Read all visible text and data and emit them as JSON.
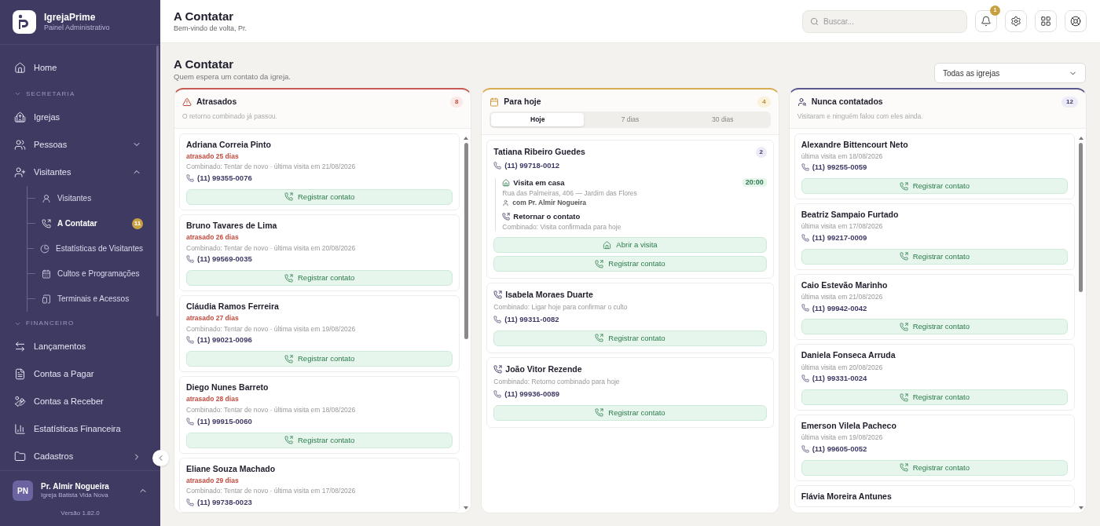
{
  "sidebar": {
    "brand": {
      "name": "IgrejaPrime",
      "subtitle": "Painel Administrativo"
    },
    "nav": [
      {
        "kind": "item",
        "label": "Home",
        "selected": false
      },
      {
        "kind": "section",
        "label": "SECRETARIA",
        "expanded": true
      },
      {
        "kind": "item",
        "label": "Igrejas",
        "selected": false
      },
      {
        "kind": "group",
        "label": "Pessoas",
        "expanded": false
      },
      {
        "kind": "group",
        "label": "Visitantes",
        "expanded": true,
        "children": [
          {
            "label": "Visitantes",
            "selected": false
          },
          {
            "label": "A Contatar",
            "selected": true,
            "badge": "11"
          },
          {
            "label": "Estatísticas de Visitantes",
            "selected": false
          },
          {
            "label": "Cultos e Programações",
            "selected": false
          },
          {
            "label": "Terminais e Acessos",
            "selected": false
          }
        ]
      },
      {
        "kind": "section",
        "label": "FINANCEIRO",
        "expanded": true
      },
      {
        "kind": "item",
        "label": "Lançamentos",
        "selected": false
      },
      {
        "kind": "item",
        "label": "Contas a Pagar",
        "selected": false
      },
      {
        "kind": "item",
        "label": "Contas a Receber",
        "selected": false
      },
      {
        "kind": "item",
        "label": "Estatísticas Financeira",
        "selected": false
      },
      {
        "kind": "link",
        "label": "Cadastros"
      }
    ],
    "user": {
      "initials": "PN",
      "name": "Pr. Almir Nogueira",
      "church": "Igreja Batista Vida Nova"
    },
    "version": "Versão 1.82.0"
  },
  "header": {
    "title": "A Contatar",
    "subtitle": "Bem-vindo de volta, Pr.",
    "search": {
      "placeholder": "Buscar..."
    },
    "notifications": "1"
  },
  "page": {
    "title": "A Contatar",
    "subtitle": "Quem espera um contato da igreja.",
    "filter": "Todas as igrejas"
  },
  "columns": [
    {
      "kind": "overdue",
      "title": "Atrasados",
      "count": "8",
      "subtitle": "O retorno combinado já passou.",
      "color": "#c65a54",
      "items": [
        {
          "name": "Adriana Correia Pinto",
          "late": "atrasado 25 dias",
          "note": "Combinado: Tentar de novo · última visita em 21/08/2026",
          "phone": "(11) 99355-0076",
          "action": "Registrar contato"
        },
        {
          "name": "Bruno Tavares de Lima",
          "late": "atrasado 26 dias",
          "note": "Combinado: Tentar de novo · última visita em 20/08/2026",
          "phone": "(11) 99569-0035",
          "action": "Registrar contato"
        },
        {
          "name": "Cláudia Ramos Ferreira",
          "late": "atrasado 27 dias",
          "note": "Combinado: Tentar de novo · última visita em 19/08/2026",
          "phone": "(11) 99021-0096",
          "action": "Registrar contato"
        },
        {
          "name": "Diego Nunes Barreto",
          "late": "atrasado 28 dias",
          "note": "Combinado: Tentar de novo · última visita em 18/08/2026",
          "phone": "(11) 99915-0060",
          "action": "Registrar contato"
        },
        {
          "name": "Eliane Souza Machado",
          "late": "atrasado 29 dias",
          "note": "Combinado: Tentar de novo · última visita em 17/08/2026",
          "phone": "(11) 99738-0023"
        }
      ]
    },
    {
      "kind": "today",
      "title": "Para hoje",
      "count": "4",
      "color": "#d9ac55",
      "tabs": [
        {
          "label": "Hoje",
          "selected": true
        },
        {
          "label": "7 dias",
          "selected": false
        },
        {
          "label": "30 dias",
          "selected": false
        }
      ],
      "items": [
        {
          "kind": "visit",
          "name": "Tatiana Ribeiro Guedes",
          "badge": "2",
          "phone": "(11) 99718-0012",
          "visit": {
            "title": "Visita em casa",
            "time": "20:00",
            "address": "Rua das Palmeiras, 406 — Jardim das Flores",
            "with": "com Pr. Almir Nogueira"
          },
          "callback": {
            "title": "Retornar o contato",
            "note": "Combinado: Visita confirmada para hoje"
          },
          "actions": [
            "Abrir a visita",
            "Registrar contato"
          ]
        },
        {
          "kind": "call",
          "name": "Isabela Moraes Duarte",
          "note": "Combinado: Ligar hoje para confirmar o culto",
          "phone": "(11) 99311-0082",
          "actions": [
            "Registrar contato"
          ]
        },
        {
          "kind": "call",
          "name": "João Vitor Rezende",
          "note": "Combinado: Retorno combinado para hoje",
          "phone": "(11) 99936-0089",
          "actions": [
            "Registrar contato"
          ]
        }
      ]
    },
    {
      "kind": "never",
      "title": "Nunca contatados",
      "count": "12",
      "subtitle": "Visitaram e ninguém falou com eles ainda.",
      "color": "#5c5890",
      "items": [
        {
          "name": "Alexandre Bittencourt Neto",
          "note": "última visita em 18/08/2026",
          "phone": "(11) 99255-0059",
          "action": "Registrar contato"
        },
        {
          "name": "Beatriz Sampaio Furtado",
          "note": "última visita em 17/08/2026",
          "phone": "(11) 99217-0009",
          "action": "Registrar contato"
        },
        {
          "name": "Caio Estevão Marinho",
          "note": "última visita em 21/08/2026",
          "phone": "(11) 99942-0042",
          "action": "Registrar contato"
        },
        {
          "name": "Daniela Fonseca Arruda",
          "note": "última visita em 20/08/2026",
          "phone": "(11) 99331-0024",
          "action": "Registrar contato"
        },
        {
          "name": "Emerson Vilela Pacheco",
          "note": "última visita em 19/08/2026",
          "phone": "(11) 99605-0052",
          "action": "Registrar contato"
        },
        {
          "name": "Flávia Moreira Antunes"
        }
      ]
    }
  ]
}
